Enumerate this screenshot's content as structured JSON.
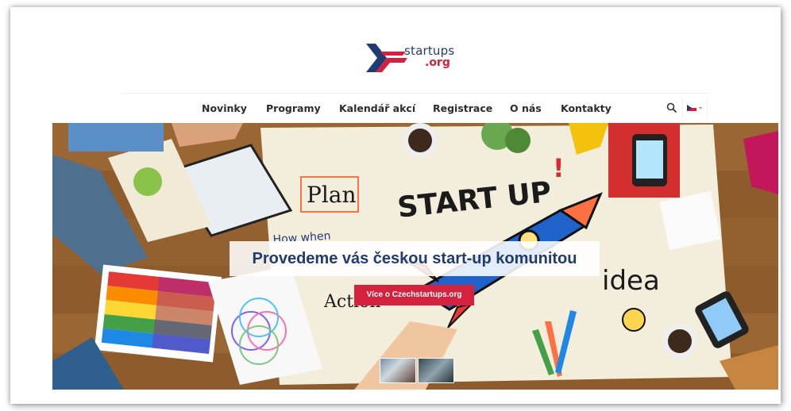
{
  "logo": {
    "line1": "startups",
    "line2": ".org"
  },
  "nav": {
    "items": [
      "Novinky",
      "Programy",
      "Kalendář akcí",
      "Registrace",
      "O nás",
      "Kontakty"
    ]
  },
  "hero": {
    "tagline": "Provedeme vás českou start-up komunitou",
    "cta_label": "Více o Czechstartups.org",
    "art_texts": {
      "start_up": "START UP",
      "exclaim": "!",
      "plan": "Plan",
      "how_when": "How when",
      "idea": "idea",
      "action": "Action"
    }
  },
  "colors": {
    "brand_red": "#d4213d",
    "brand_navy": "#1f3b73",
    "table_wood": "#8b5a2b"
  }
}
